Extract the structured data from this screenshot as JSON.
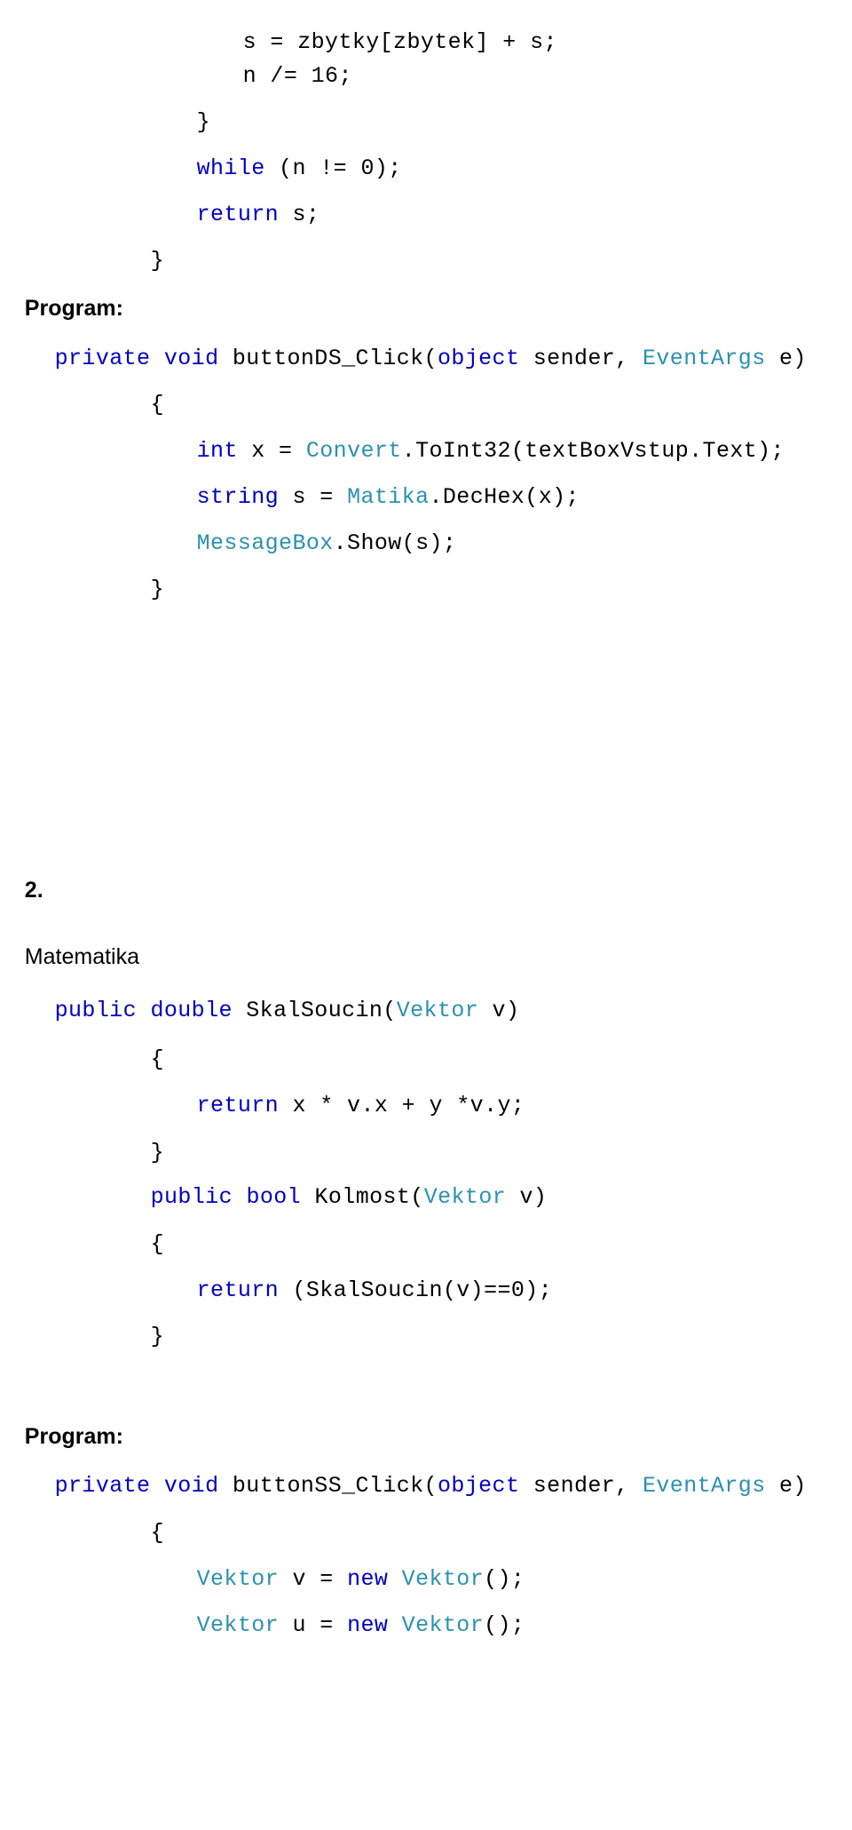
{
  "document": {
    "language": "cs",
    "background_color": "#ffffff",
    "colors": {
      "text": "#000000",
      "keyword": "#0000C0",
      "type": "#2B91AF"
    }
  },
  "headings": {
    "program_label_1": "Program:",
    "section_number_2": "2.",
    "section_title_2": "Matematika",
    "program_label_2": "Program:"
  },
  "code_lines": {
    "l01": "s = zbytky[zbytek] + s;",
    "l02": "n /= 16;",
    "l03": "}",
    "l04_kw": "while",
    "l04_rest": " (n != 0);",
    "l05_kw": "return",
    "l05_rest": " s;",
    "l06": "}",
    "l07_kw1": "private",
    "l07_kw2": "void",
    "l07_name": "buttonDS_Click(",
    "l07_kw3": "object",
    "l07_mid": " sender, ",
    "l07_ty": "EventArgs",
    "l07_end": " e)",
    "l08": "{",
    "l09_kw": "int",
    "l09_mid": " x = ",
    "l09_ty": "Convert",
    "l09_end": ".ToInt32(textBoxVstup.Text);",
    "l10_kw": "string",
    "l10_mid": " s = ",
    "l10_ty": "Matika",
    "l10_end": ".DecHex(x);",
    "l11_ty": "MessageBox",
    "l11_end": ".Show(s);",
    "l12": "}",
    "l13_kw1": "public",
    "l13_kw2": "double",
    "l13_name": " SkalSoucin(",
    "l13_ty": "Vektor",
    "l13_end": " v)",
    "l14": "{",
    "l15_kw": "return",
    "l15_rest": " x * v.x + y *v.y;",
    "l16": "}",
    "l17_kw1": "public",
    "l17_kw2": "bool",
    "l17_name": " Kolmost(",
    "l17_ty": "Vektor",
    "l17_end": " v)",
    "l18": "{",
    "l19_kw": "return",
    "l19_rest": " (SkalSoucin(v)==0);",
    "l20": "}",
    "l21_kw1": "private",
    "l21_kw2": "void",
    "l21_name": "buttonSS_Click(",
    "l21_kw3": "object",
    "l21_mid": " sender, ",
    "l21_ty": "EventArgs",
    "l21_end": " e)",
    "l22": "{",
    "l23_ty1": "Vektor",
    "l23_mid": " v = ",
    "l23_kw": "new",
    "l23_ty2": " Vektor",
    "l23_end": "();",
    "l24_ty1": "Vektor",
    "l24_mid": " u = ",
    "l24_kw": "new",
    "l24_ty2": " Vektor",
    "l24_end": "();"
  }
}
